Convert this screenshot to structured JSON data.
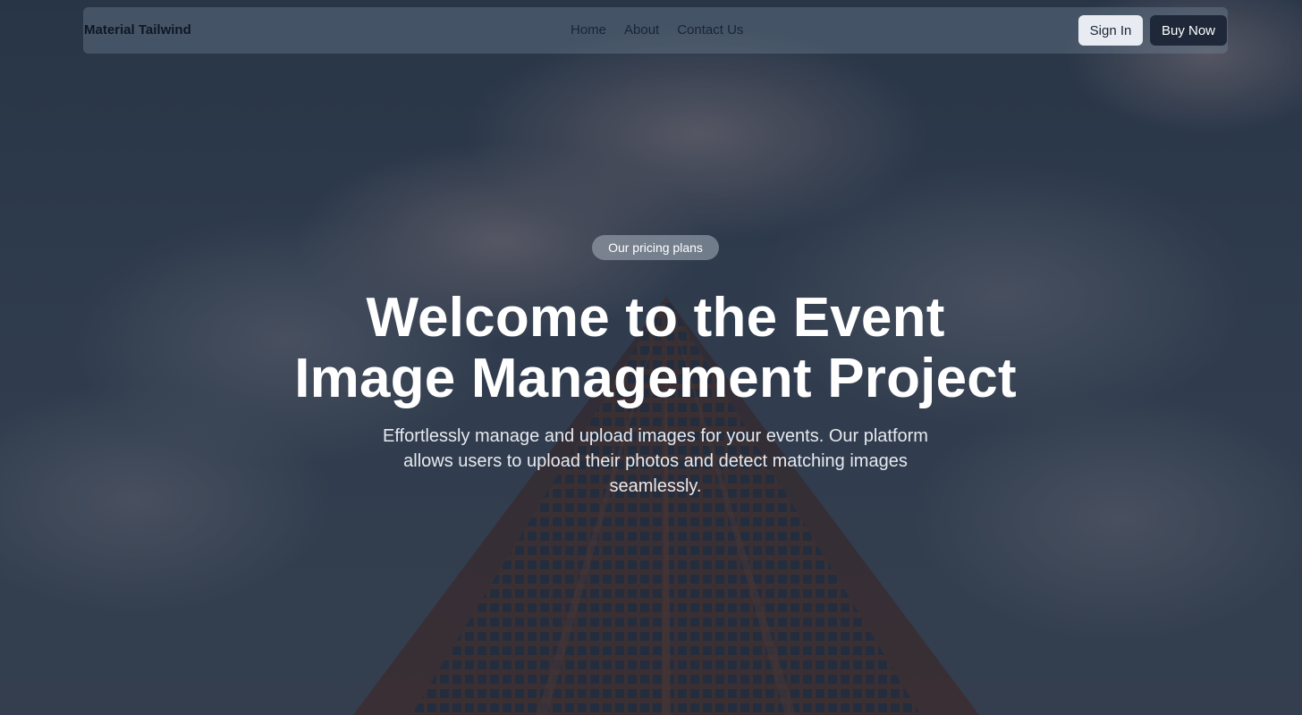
{
  "navbar": {
    "brand": "Material Tailwind",
    "links": [
      "Home",
      "About",
      "Contact Us"
    ],
    "sign_in_label": "Sign In",
    "buy_now_label": "Buy Now"
  },
  "hero": {
    "badge": "Our pricing plans",
    "title_line1": "Welcome to the Event",
    "title_line2": "Image Management Project",
    "subtitle": "Effortlessly manage and upload images for your events. Our platform allows users to upload their photos and detect matching images seamlessly."
  },
  "colors": {
    "navbar_bg": "#5b6b7c",
    "sign_in_bg": "#e8ecf2",
    "buy_now_bg": "#1e2838",
    "brand_text": "#0f1624"
  }
}
